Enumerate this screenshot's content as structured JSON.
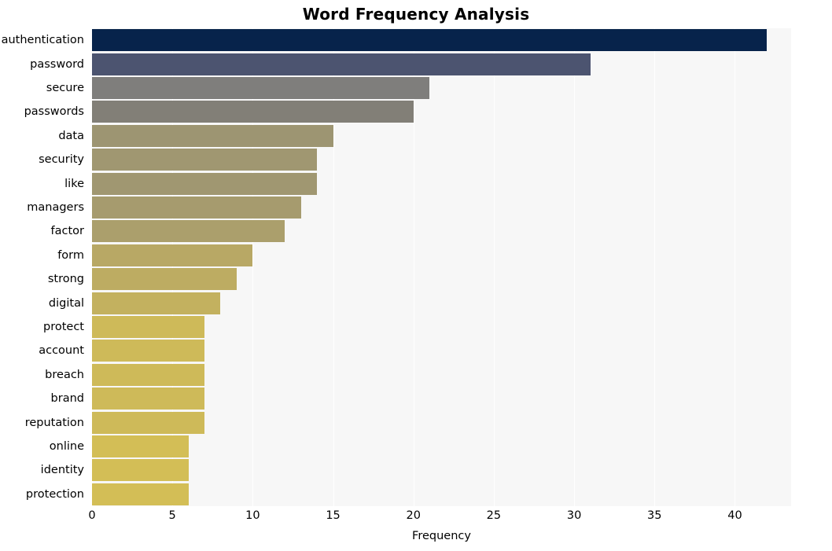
{
  "chart_data": {
    "type": "bar",
    "orientation": "horizontal",
    "title": "Word Frequency Analysis",
    "xlabel": "Frequency",
    "ylabel": "",
    "xlim": [
      0,
      43.5
    ],
    "xticks": [
      0,
      5,
      10,
      15,
      20,
      25,
      30,
      35,
      40
    ],
    "grid": true,
    "grid_axis": "x",
    "legend": null,
    "categories": [
      "authentication",
      "password",
      "secure",
      "passwords",
      "data",
      "security",
      "like",
      "managers",
      "factor",
      "form",
      "strong",
      "digital",
      "protect",
      "account",
      "breach",
      "brand",
      "reputation",
      "online",
      "identity",
      "protection"
    ],
    "values": [
      42,
      31,
      21,
      20,
      15,
      14,
      14,
      13,
      12,
      10,
      9,
      8,
      7,
      7,
      7,
      7,
      7,
      6,
      6,
      6
    ],
    "bar_colors": [
      "#07234b",
      "#4c5470",
      "#7f7e7c",
      "#827f77",
      "#9d9572",
      "#a09771",
      "#a09771",
      "#a69b6e",
      "#ab9f6c",
      "#b8a865",
      "#bdac62",
      "#c3b15f",
      "#ceba59",
      "#ceba59",
      "#ceba59",
      "#ceba59",
      "#ceba59",
      "#d3be56",
      "#d3be56",
      "#d3be56"
    ],
    "plot_background": "#f7f7f7",
    "figure_background": "#ffffff"
  }
}
